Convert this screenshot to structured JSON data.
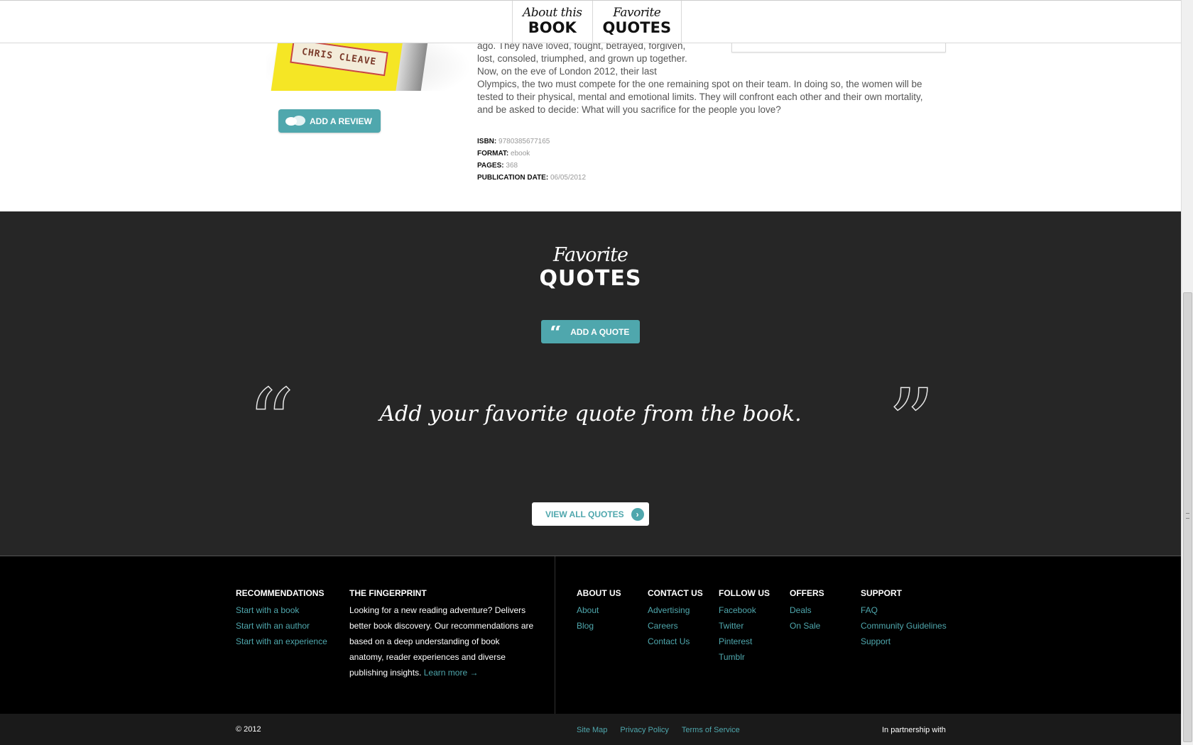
{
  "nav": {
    "tabs": [
      {
        "small": "About this",
        "big": "BOOK"
      },
      {
        "small": "Favorite",
        "big": "QUOTES"
      }
    ]
  },
  "book": {
    "cover_text": "CHRIS CLEAVE",
    "add_review_label": "ADD A REVIEW",
    "description_lines": [
      "ago. They have loved, fought, betrayed, forgiven,",
      "lost, consoled, triumphed, and grown up together.",
      "Now, on the eve of London 2012, their last",
      "Olympics, the two must compete for the one remaining spot on their team. In doing so, the women will be",
      "tested to their physical, mental and emotional limits. They will confront each other and their own mortality,",
      "and be asked to decide: What will you sacrifice for the people you love?"
    ],
    "meta": [
      {
        "label": "ISBN:",
        "value": "9780385677165"
      },
      {
        "label": "FORMAT:",
        "value": "ebook"
      },
      {
        "label": "PAGES:",
        "value": "368"
      },
      {
        "label": "PUBLICATION DATE:",
        "value": "06/05/2012"
      }
    ]
  },
  "quotes": {
    "heading_small": "Favorite",
    "heading_big": "QUOTES",
    "add_quote_label": "ADD A QUOTE",
    "open_mark": "“",
    "close_mark": "”",
    "prompt": "Add your favorite quote from the book.",
    "view_all_label": "VIEW ALL QUOTES",
    "view_all_arrow": "›"
  },
  "footer": {
    "recommendations": {
      "title": "RECOMMENDATIONS",
      "links": [
        "Start with a book",
        "Start with an author",
        "Start with an experience"
      ]
    },
    "fingerprint": {
      "title": "THE FINGERPRINT",
      "text": "Looking for a new reading adventure? Delivers better book discovery. Our recommendations are based on a deep understanding of book anatomy, reader experiences and diverse publishing insights.",
      "link": "Learn more →"
    },
    "about": {
      "title": "ABOUT US",
      "links": [
        "About",
        "Blog"
      ]
    },
    "contact": {
      "title": "CONTACT US",
      "links": [
        "Advertising",
        "Careers",
        "Contact Us"
      ]
    },
    "follow": {
      "title": "FOLLOW US",
      "links": [
        "Facebook",
        "Twitter",
        "Pinterest",
        "Tumblr"
      ]
    },
    "offers": {
      "title": "OFFERS",
      "links": [
        "Deals",
        "On Sale"
      ]
    },
    "support": {
      "title": "SUPPORT",
      "links": [
        "FAQ",
        "Community Guidelines",
        "Support"
      ]
    }
  },
  "bottom": {
    "copyright": "© 2012",
    "links": [
      "Site Map",
      "Privacy Policy",
      "Terms of Service"
    ],
    "partner": "In partnership with"
  },
  "colors": {
    "accent": "#4fa7ad",
    "dark_section": "#262626",
    "footer": "#000000"
  }
}
